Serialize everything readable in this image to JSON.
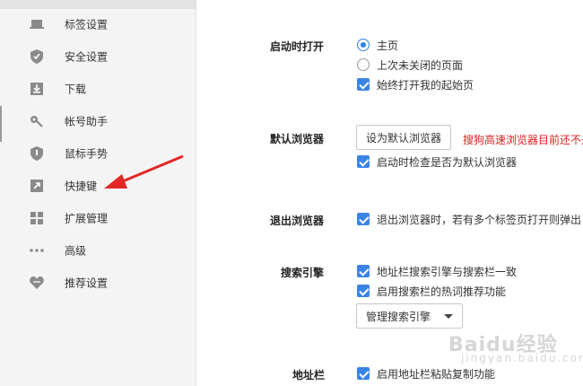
{
  "sidebar": {
    "items": [
      {
        "label": "标签设置",
        "icon": "tab-icon"
      },
      {
        "label": "安全设置",
        "icon": "shield-check-icon"
      },
      {
        "label": "下载",
        "icon": "download-icon"
      },
      {
        "label": "帐号助手",
        "icon": "key-icon"
      },
      {
        "label": "鼠标手势",
        "icon": "mouse-gesture-icon"
      },
      {
        "label": "快捷键",
        "icon": "shortcut-arrow-icon"
      },
      {
        "label": "扩展管理",
        "icon": "extensions-grid-icon"
      },
      {
        "label": "高级",
        "icon": "more-dots-icon"
      },
      {
        "label": "推荐设置",
        "icon": "heart-icon"
      }
    ]
  },
  "startup": {
    "label": "启动时打开",
    "options": [
      {
        "label": "主页",
        "type": "radio",
        "checked": true
      },
      {
        "label": "上次未关闭的页面",
        "type": "radio",
        "checked": false
      },
      {
        "label": "始终打开我的起始页",
        "type": "checkbox",
        "checked": true
      }
    ]
  },
  "default_browser": {
    "label": "默认浏览器",
    "button": "设为默认浏览器",
    "warning": "搜狗高速浏览器目前还不是",
    "check_label": "启动时检查是否为默认浏览器"
  },
  "exit_browser": {
    "label": "退出浏览器",
    "check_label": "退出浏览器时，若有多个标签页打开则弹出"
  },
  "search_engine": {
    "label": "搜索引擎",
    "options": [
      {
        "label": "地址栏搜索引擎与搜索栏一致"
      },
      {
        "label": "启用搜索栏的热词推荐功能"
      }
    ],
    "manage_button": "管理搜索引擎"
  },
  "address_bar": {
    "label": "地址栏",
    "check_label": "启用地址栏粘贴复制功能"
  },
  "watermark": {
    "text": "Baidu经验",
    "sub": "jingyan.baidu.com"
  },
  "colors": {
    "accent": "#3b84e5",
    "warning": "#e02020",
    "arrow": "#e32626"
  }
}
